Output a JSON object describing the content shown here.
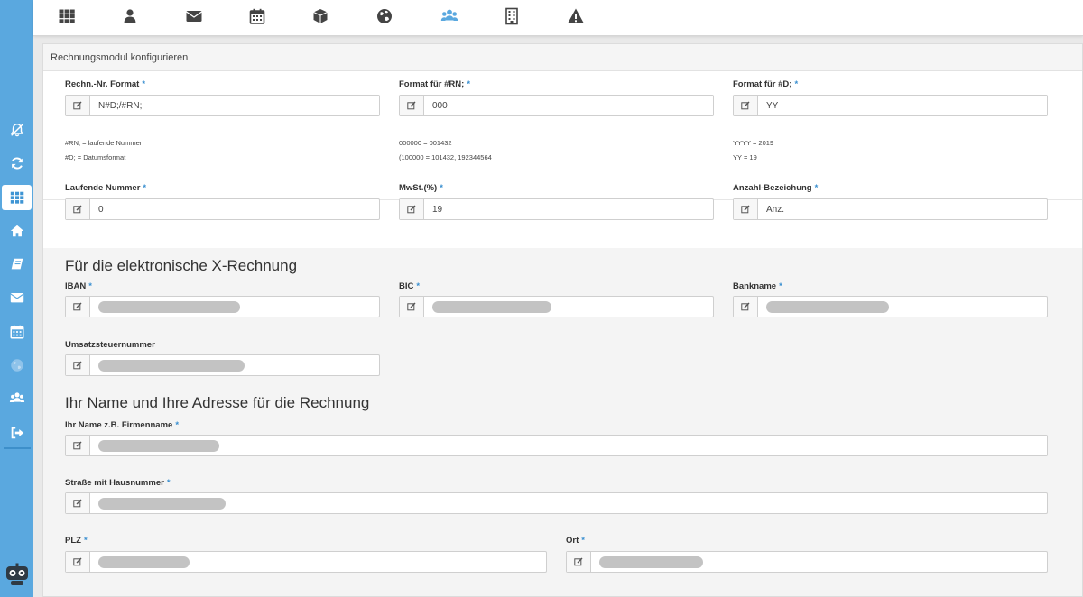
{
  "top_icons": [
    "apps-grid-icon",
    "user-icon",
    "envelope-icon",
    "calendar-icon",
    "cube-icon",
    "globe-icon",
    "users-icon",
    "building-icon",
    "warning-icon"
  ],
  "side_icons": [
    "bell-slash-icon",
    "refresh-icon",
    "apps-grid-icon",
    "home-icon",
    "book-icon",
    "envelope-icon",
    "calendar-icon",
    "globe-icon",
    "users-icon",
    "logout-icon"
  ],
  "panel": {
    "title": "Rechnungsmodul konfigurieren"
  },
  "fields": {
    "rn_format": {
      "label": "Rechn.-Nr. Format",
      "value": "N#D;/#RN;"
    },
    "format_rn": {
      "label": "Format für #RN;",
      "value": "000"
    },
    "format_d": {
      "label": "Format für #D;",
      "value": "YY"
    },
    "laufende_nummer": {
      "label": "Laufende Nummer",
      "value": "0"
    },
    "mwst": {
      "label": "MwSt.(%)",
      "value": "19"
    },
    "anzahl": {
      "label": "Anzahl-Bezeichung",
      "value": "Anz."
    },
    "iban": {
      "label": "IBAN",
      "value": ""
    },
    "bic": {
      "label": "BIC",
      "value": ""
    },
    "bankname": {
      "label": "Bankname",
      "value": ""
    },
    "ust": {
      "label": "Umsatzsteuernummer",
      "value": ""
    },
    "name": {
      "label": "Ihr Name z.B. Firmenname",
      "value": ""
    },
    "strasse": {
      "label": "Straße mit Hausnummer",
      "value": ""
    },
    "plz": {
      "label": "PLZ",
      "value": ""
    },
    "ort": {
      "label": "Ort",
      "value": ""
    }
  },
  "hints": {
    "col1_line1": "#RN; = laufende Nummer",
    "col1_line2": "#D; = Datumsformat",
    "col2_line1": "000000 = 001432",
    "col2_line2": "(100000 = 101432, 192344564",
    "col3_line1": "YYYY = 2019",
    "col3_line2": "YY = 19"
  },
  "sections": {
    "x_rechnung": "Für die elektronische X-Rechnung",
    "name_adresse": "Ihr Name und Ihre Adresse für die Rechnung"
  },
  "required_marker": "*",
  "colors": {
    "sidebar": "#5aa8df",
    "accent": "#3a8fd0",
    "active_top_icon": "#5aa8df"
  }
}
